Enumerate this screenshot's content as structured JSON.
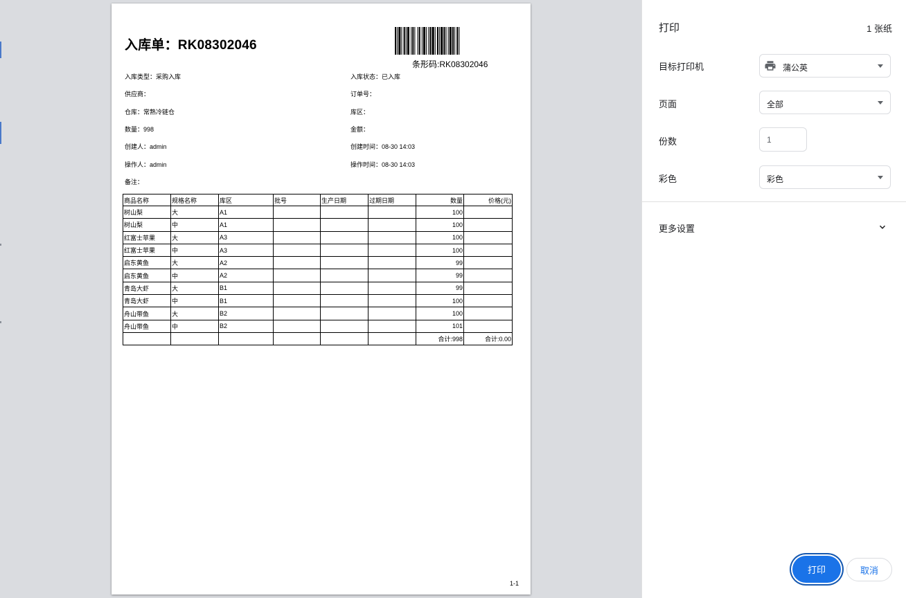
{
  "document": {
    "title": "入库单：RK08302046",
    "barcode_label": "条形码:RK08302046",
    "fields": {
      "inbound_type": "入库类型：采购入库",
      "inbound_status": "入库状态：已入库",
      "supplier": "供应商：",
      "order_no": "订单号：",
      "warehouse": "仓库：常熟冷链仓",
      "zone": "库区：",
      "quantity": "数量：998",
      "amount": "金额：",
      "creator": "创建人：admin",
      "created_time": "创建时间：08-30 14:03",
      "operator": "操作人：admin",
      "operated_time": "操作时间：08-30 14:03",
      "remark": "备注："
    },
    "table": {
      "headers": [
        "商品名称",
        "规格名称",
        "库区",
        "批号",
        "生产日期",
        "过期日期",
        "数量",
        "价格(元)"
      ],
      "rows": [
        [
          "树山梨",
          "大",
          "A1",
          "",
          "",
          "",
          "100",
          ""
        ],
        [
          "树山梨",
          "中",
          "A1",
          "",
          "",
          "",
          "100",
          ""
        ],
        [
          "红富士苹果",
          "大",
          "A3",
          "",
          "",
          "",
          "100",
          ""
        ],
        [
          "红富士苹果",
          "中",
          "A3",
          "",
          "",
          "",
          "100",
          ""
        ],
        [
          "启东黄鱼",
          "大",
          "A2",
          "",
          "",
          "",
          "99",
          ""
        ],
        [
          "启东黄鱼",
          "中",
          "A2",
          "",
          "",
          "",
          "99",
          ""
        ],
        [
          "青岛大虾",
          "大",
          "B1",
          "",
          "",
          "",
          "99",
          ""
        ],
        [
          "青岛大虾",
          "中",
          "B1",
          "",
          "",
          "",
          "100",
          ""
        ],
        [
          "舟山带鱼",
          "大",
          "B2",
          "",
          "",
          "",
          "100",
          ""
        ],
        [
          "舟山带鱼",
          "中",
          "B2",
          "",
          "",
          "",
          "101",
          ""
        ]
      ],
      "footer": [
        "",
        "",
        "",
        "",
        "",
        "",
        "合计:998",
        "合计:0.00"
      ]
    },
    "page_number": "1-1"
  },
  "print_panel": {
    "title": "打印",
    "sheet_count": "1 张纸",
    "destination_label": "目标打印机",
    "destination_value": "蒲公英",
    "pages_label": "页面",
    "pages_value": "全部",
    "copies_label": "份数",
    "copies_value": "1",
    "color_label": "彩色",
    "color_value": "彩色",
    "more_settings": "更多设置",
    "print_button": "打印",
    "cancel_button": "取消"
  }
}
